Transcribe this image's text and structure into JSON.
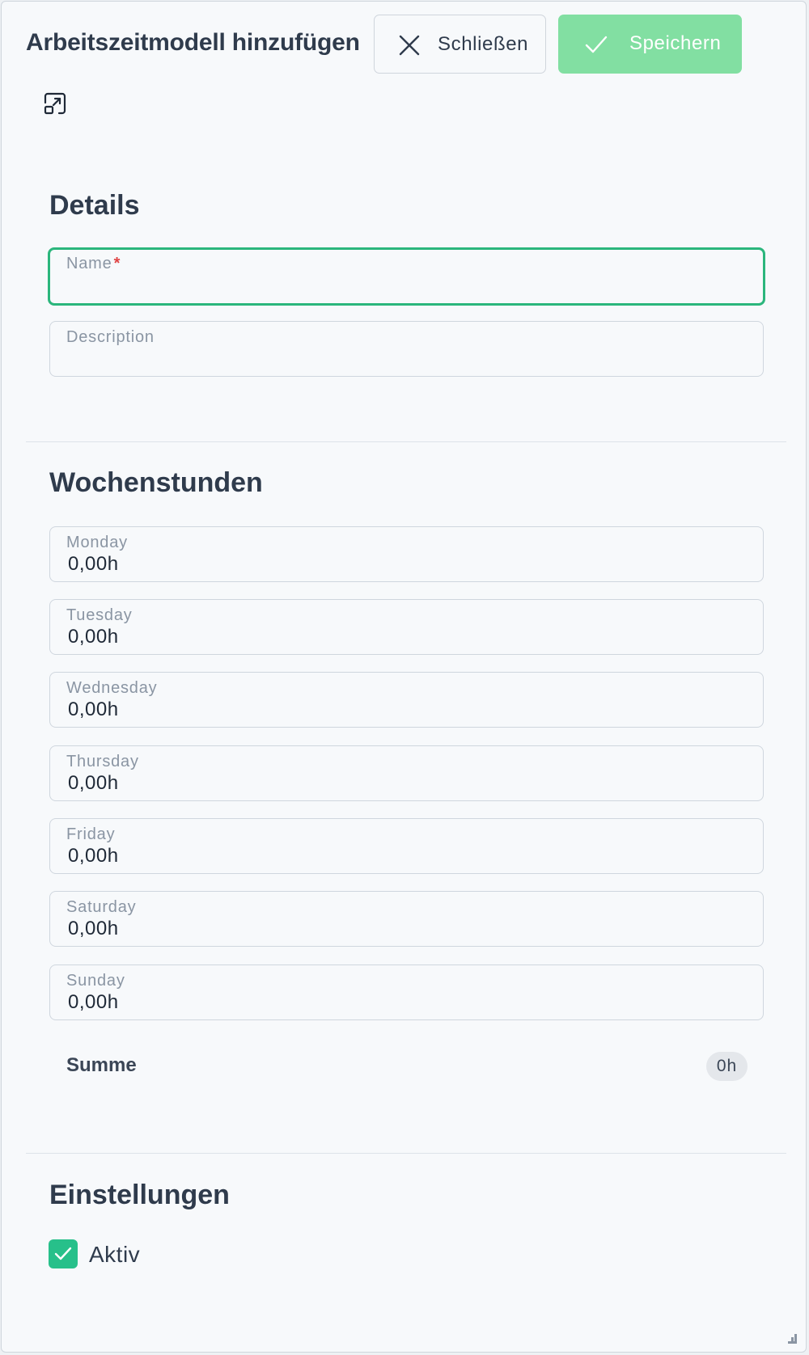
{
  "header": {
    "title": "Arbeitszeitmodell hinzufügen",
    "close_label": "Schließen",
    "save_label": "Speichern",
    "close_icon": "x-icon",
    "save_icon": "check-icon",
    "expand_icon": "expand-icon"
  },
  "details": {
    "title": "Details",
    "name": {
      "label": "Name",
      "required_mark": "*",
      "value": ""
    },
    "description": {
      "label": "Description",
      "value": ""
    }
  },
  "week": {
    "title": "Wochenstunden",
    "days": [
      {
        "label": "Monday",
        "value": "0,00h"
      },
      {
        "label": "Tuesday",
        "value": "0,00h"
      },
      {
        "label": "Wednesday",
        "value": "0,00h"
      },
      {
        "label": "Thursday",
        "value": "0,00h"
      },
      {
        "label": "Friday",
        "value": "0,00h"
      },
      {
        "label": "Saturday",
        "value": "0,00h"
      },
      {
        "label": "Sunday",
        "value": "0,00h"
      }
    ],
    "sum_label": "Summe",
    "sum_value": "0h"
  },
  "settings": {
    "title": "Einstellungen",
    "active_label": "Aktiv",
    "active_checked": true
  },
  "colors": {
    "accent_green": "#27c08a",
    "save_button": "#82dfa2",
    "focus_border": "#2bb67c",
    "required": "#e04444"
  }
}
